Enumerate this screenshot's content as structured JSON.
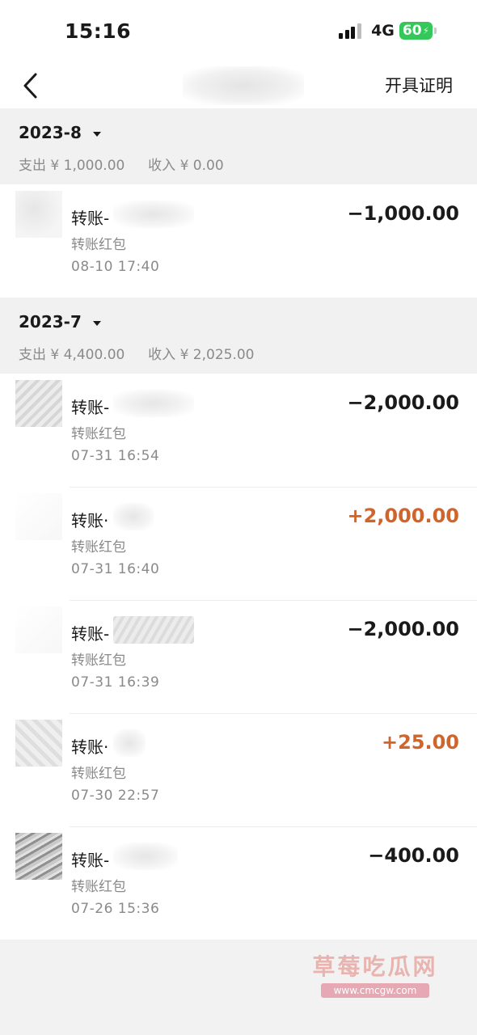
{
  "status_bar": {
    "time": "15:16",
    "network": "4G",
    "battery": "60"
  },
  "nav": {
    "action_label": "开具证明"
  },
  "months": [
    {
      "label": "2023-8",
      "expense_label": "支出",
      "expense": "¥ 1,000.00",
      "income_label": "收入",
      "income": "¥ 0.00",
      "transactions": [
        {
          "name": "转账-",
          "type": "转账红包",
          "time": "08-10  17:40",
          "amount": "−1,000.00",
          "direction": "out"
        }
      ]
    },
    {
      "label": "2023-7",
      "expense_label": "支出",
      "expense": "¥ 4,400.00",
      "income_label": "收入",
      "income": "¥ 2,025.00",
      "transactions": [
        {
          "name": "转账-",
          "type": "转账红包",
          "time": "07-31  16:54",
          "amount": "−2,000.00",
          "direction": "out"
        },
        {
          "name": "转账·",
          "type": "转账红包",
          "time": "07-31  16:40",
          "amount": "+2,000.00",
          "direction": "in"
        },
        {
          "name": "转账-",
          "type": "转账红包",
          "time": "07-31  16:39",
          "amount": "−2,000.00",
          "direction": "out"
        },
        {
          "name": "转账·",
          "type": "转账红包",
          "time": "07-30  22:57",
          "amount": "+25.00",
          "direction": "in"
        },
        {
          "name": "转账-",
          "type": "转账红包",
          "time": "07-26  15:36",
          "amount": "−400.00",
          "direction": "out"
        }
      ]
    }
  ],
  "watermark": {
    "text": "草莓吃瓜网",
    "url": "www.cmcgw.com"
  },
  "colors": {
    "income": "#d0652c",
    "expense": "#1a1a1a",
    "secondary_text": "#8a8a8a"
  }
}
